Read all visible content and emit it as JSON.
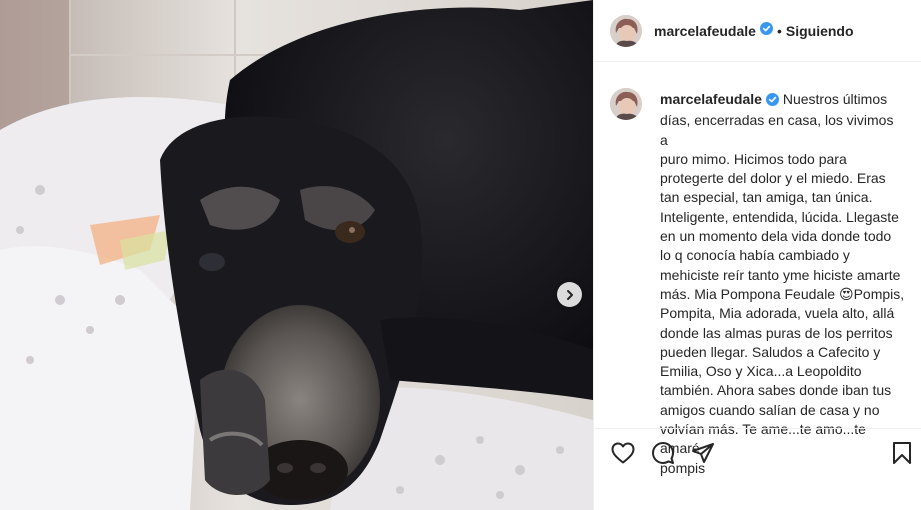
{
  "post": {
    "author": "marcelafeudale",
    "follow_status": "Siguiendo",
    "separator": "•",
    "caption_lines": [
      "Nuestros últimos",
      "días, encerradas en casa, los vivimos a",
      "puro mimo. Hicimos todo para",
      "protegerte del dolor y el miedo. Eras",
      "tan especial, tan amiga, tan única.",
      "Inteligente, entendida, lúcida. Llegaste",
      "en un momento dela vida donde todo",
      "lo q conocía había cambiado y",
      "mehiciste reír tanto yme hiciste amarte",
      "más. Mia Pompona Feudale 😍Pompis,",
      "Pompita, Mia adorada, vuela alto, allá",
      "donde las almas puras de los perritos",
      "pueden llegar. Saludos a Cafecito y",
      "Emilia, Oso y Xica...a Leopoldito",
      "también. Ahora sabes donde iban tus",
      "amigos cuando salían de casa y no",
      "volvían más. Te ame...te amo...te amaré",
      "pompis"
    ]
  },
  "icons": {
    "verified": "verified-badge-icon",
    "carousel_next": "chevron-right-icon",
    "like": "heart-icon",
    "comment": "comment-bubble-icon",
    "share": "paper-plane-icon",
    "save": "bookmark-icon"
  },
  "colors": {
    "verified_blue": "#3897f0",
    "text": "#262626",
    "divider": "#efefef"
  }
}
